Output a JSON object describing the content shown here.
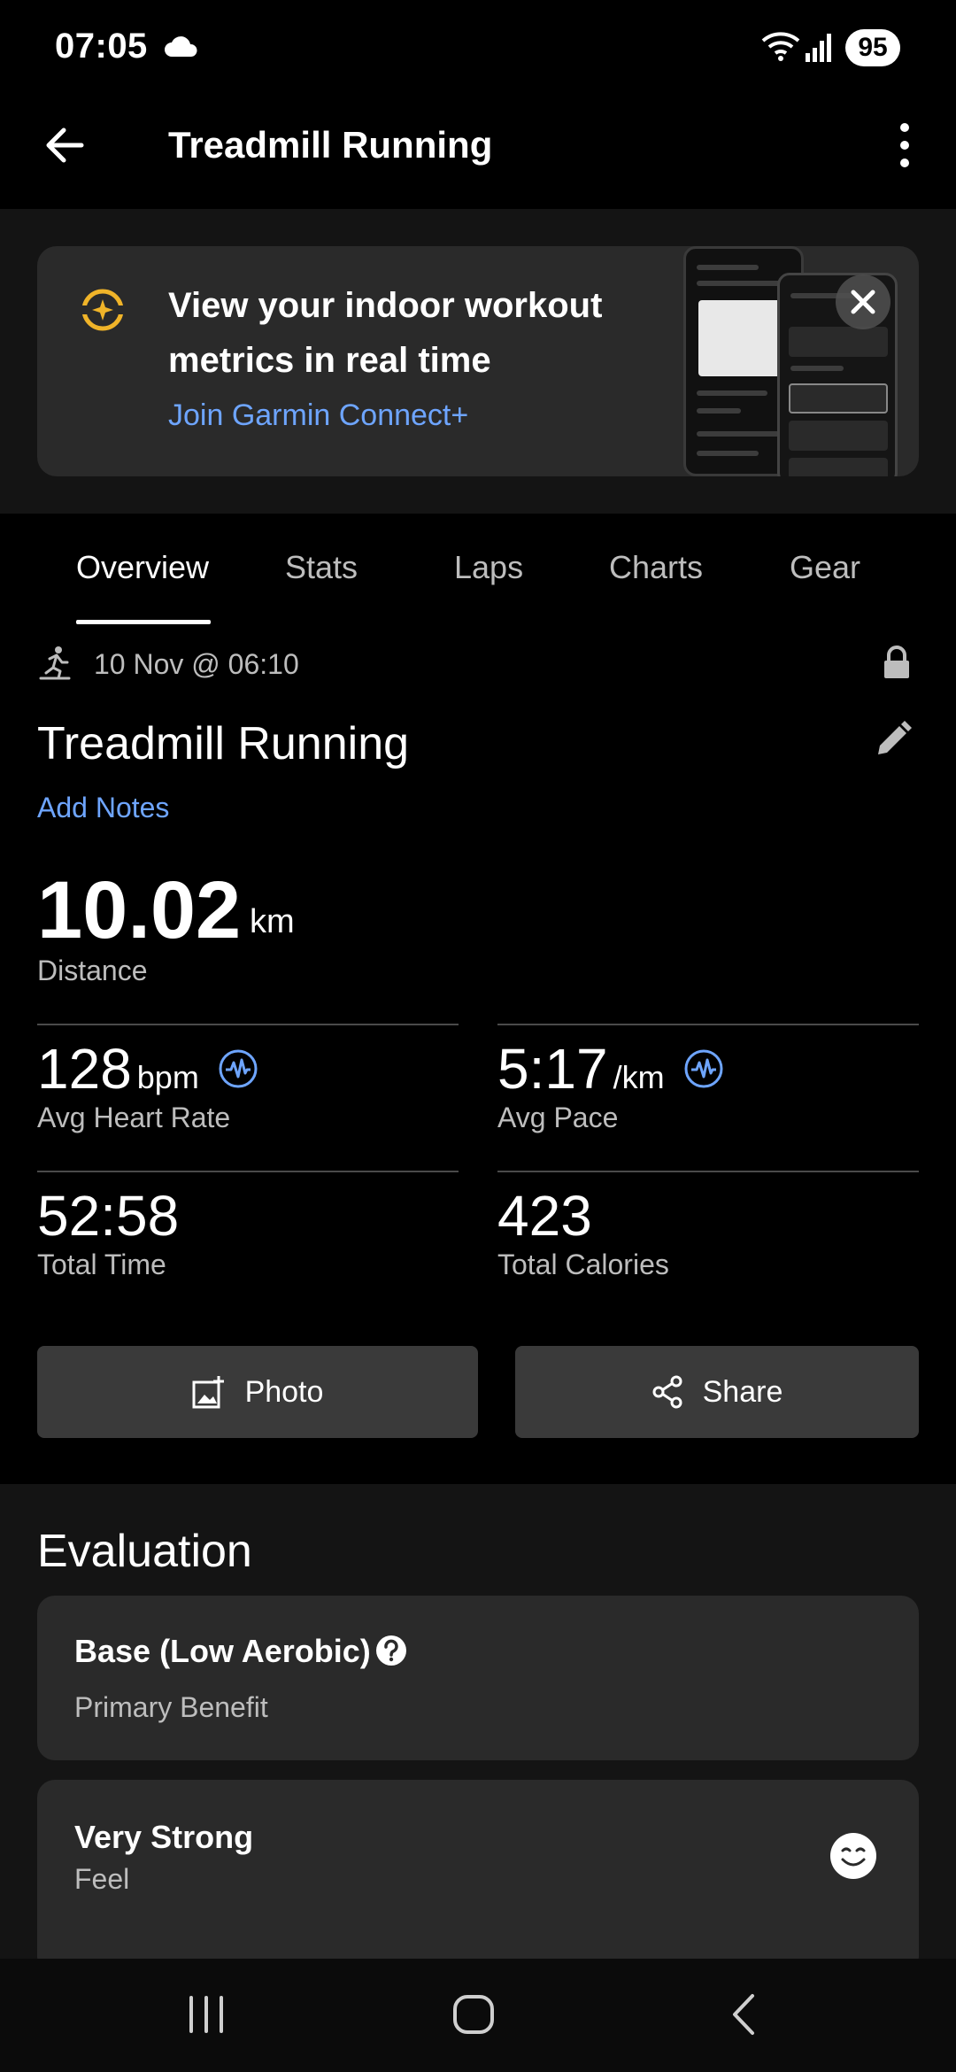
{
  "status_bar": {
    "time": "07:05",
    "battery": "95",
    "cloud_icon": "cloud-icon",
    "wifi_icon": "wifi-icon",
    "signal_icon": "signal-icon"
  },
  "app_bar": {
    "title": "Treadmill Running",
    "back_icon": "arrow-left-icon",
    "more_icon": "more-vertical-icon"
  },
  "promo": {
    "title": "View your indoor workout metrics in real time",
    "link": "Join Garmin Connect+",
    "icon": "connect-plus-icon",
    "close_icon": "close-icon",
    "accent": "#f0b429"
  },
  "tabs": [
    {
      "label": "Overview",
      "active": true
    },
    {
      "label": "Stats",
      "active": false
    },
    {
      "label": "Laps",
      "active": false
    },
    {
      "label": "Charts",
      "active": false
    },
    {
      "label": "Gear",
      "active": false
    }
  ],
  "activity": {
    "date": "10 Nov @ 06:10",
    "title": "Treadmill Running",
    "add_notes": "Add Notes",
    "distance_value": "10.02",
    "distance_unit": "km",
    "distance_label": "Distance"
  },
  "metrics": {
    "heart_rate": {
      "value": "128",
      "unit": "bpm",
      "label": "Avg Heart Rate"
    },
    "pace": {
      "value": "5:17",
      "unit": "/km",
      "label": "Avg Pace"
    },
    "time": {
      "value": "52:58",
      "label": "Total Time"
    },
    "calories": {
      "value": "423",
      "label": "Total Calories"
    }
  },
  "actions": {
    "photo": "Photo",
    "share": "Share"
  },
  "evaluation": {
    "title": "Evaluation",
    "benefit": {
      "title": "Base (Low Aerobic)",
      "subtitle": "Primary Benefit"
    },
    "feel": {
      "title": "Very Strong",
      "subtitle": "Feel"
    }
  },
  "colors": {
    "link": "#6ea5ff",
    "card": "#2a2a2a",
    "button": "#3a3a3a"
  }
}
